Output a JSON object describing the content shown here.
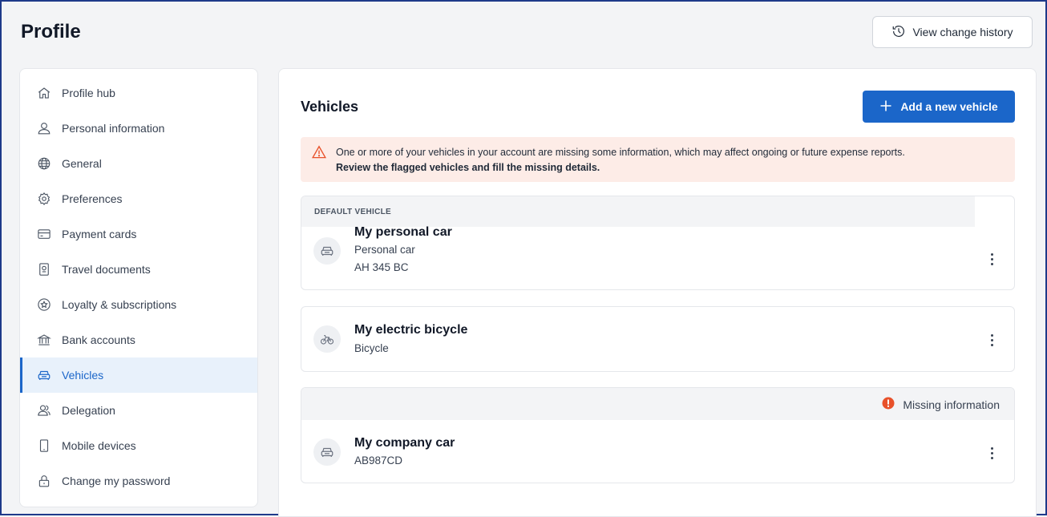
{
  "page": {
    "title": "Profile"
  },
  "header": {
    "history_label": "View change history"
  },
  "sidebar": {
    "items": [
      {
        "label": "Profile hub",
        "icon": "home-icon"
      },
      {
        "label": "Personal information",
        "icon": "user-icon"
      },
      {
        "label": "General",
        "icon": "globe-icon"
      },
      {
        "label": "Preferences",
        "icon": "gear-icon"
      },
      {
        "label": "Payment cards",
        "icon": "card-icon"
      },
      {
        "label": "Travel documents",
        "icon": "passport-icon"
      },
      {
        "label": "Loyalty & subscriptions",
        "icon": "star-badge-icon"
      },
      {
        "label": "Bank accounts",
        "icon": "bank-icon"
      },
      {
        "label": "Vehicles",
        "icon": "car-icon",
        "active": true
      },
      {
        "label": "Delegation",
        "icon": "users-icon"
      },
      {
        "label": "Mobile devices",
        "icon": "phone-icon"
      },
      {
        "label": "Change my password",
        "icon": "lock-icon"
      }
    ]
  },
  "vehicles": {
    "title": "Vehicles",
    "add_label": "Add a new vehicle",
    "alert": {
      "line1": "One or more of your vehicles in your account are missing some information, which may affect ongoing or future expense reports.",
      "line2": "Review the flagged vehicles and fill the missing details."
    },
    "cards": [
      {
        "header": "DEFAULT VEHICLE",
        "name": "My personal car",
        "type": "Personal car",
        "plate": "AH 345 BC",
        "icon": "car-icon"
      },
      {
        "name": "My electric bicycle",
        "type": "Bicycle",
        "icon": "bicycle-icon"
      },
      {
        "badge": "Missing information",
        "name": "My company car",
        "plate": "AB987CD",
        "icon": "car-icon"
      }
    ]
  },
  "colors": {
    "primary": "#1b66c9",
    "alert_bg": "#fdece7",
    "warning": "#e8512a"
  }
}
